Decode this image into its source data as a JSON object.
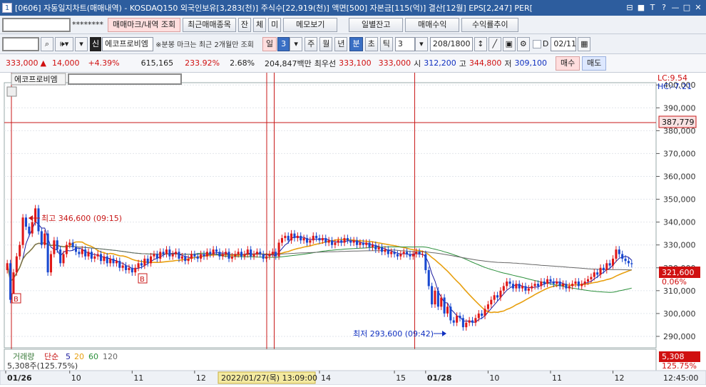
{
  "window": {
    "number": "1",
    "title": "[0606] 자동일지차트(매매내역) - KOSDAQ150 외국인보유[3,283(천)] 주식수[22,919(천)] 액면[500] 자본금[115(억)] 결산[12월] EPS[2,247] PER[",
    "controls": [
      "⊟",
      "■",
      "T",
      "?",
      "—",
      "□",
      "✕"
    ]
  },
  "toolbar1": {
    "account_mask": "********",
    "buttons": [
      "매매마크/내역 조회",
      "최근매매종목",
      "잔",
      "체",
      "미",
      "메모보기",
      "일별잔고",
      "매매수익",
      "수익률추이"
    ]
  },
  "toolbar2": {
    "stock_name": "에코프로비엠",
    "sin_label": "신",
    "note": "※분봉 마크는 최근 2개월만 조회",
    "period_buttons": [
      "일",
      "주",
      "월",
      "년",
      "분",
      "초",
      "틱"
    ],
    "period_value": "3",
    "minute_value": "3",
    "count": "208/1800",
    "date": "02/11",
    "date_check_label": "D"
  },
  "quote": {
    "price": "333,000",
    "change": "14,000",
    "change_pct": "+4.39%",
    "volume": "615,165",
    "vol_ratio": "233.92%",
    "turnover": "2.68%",
    "amount": "204,847백만",
    "best_label": "최우선",
    "ask": "333,100",
    "bid": "333,000",
    "open_label": "시",
    "open": "312,200",
    "high_label": "고",
    "high": "344,800",
    "low_label": "저",
    "low": "309,100",
    "buy": "매수",
    "sell": "매도"
  },
  "chart_panel": {
    "stock_tag": "에코프로비엠",
    "lc": "LC:9.54",
    "hc": "HC:-7.21",
    "crosshair_price": "387,779",
    "current_price": "321,600",
    "current_pct": "0.06%",
    "high_note": "최고 346,600 (09:15)",
    "low_note": "최저 293,600 (09:42)",
    "volume_legend": {
      "label": "거래량",
      "ma_label": "단순",
      "ma": [
        "5",
        "20",
        "60",
        "120"
      ]
    },
    "volume_text": "5,308주(125.75%)",
    "volume_value": "5,308",
    "volume_pct": "125.75%",
    "cursor_time_label": "2022/01/27(목) 13:09:00",
    "clock": "12:45:00",
    "marker_buy": "B"
  },
  "chart_data": {
    "type": "candlestick",
    "interval": "3분",
    "y_ticks": [
      400000,
      390000,
      380000,
      370000,
      360000,
      350000,
      340000,
      330000,
      320000,
      310000,
      300000,
      290000
    ],
    "y_tick_labels": [
      "400,000",
      "390,000",
      "380,000",
      "370,000",
      "360,000",
      "350,000",
      "340,000",
      "330,000",
      "320,000",
      "310,000",
      "300,000",
      "290,000"
    ],
    "ylim": [
      285000,
      401000
    ],
    "x_tick_labels": [
      "01/26",
      "10",
      "11",
      "12",
      "14",
      "15",
      "01/28",
      "10",
      "11",
      "12"
    ],
    "x_tick_times": [
      0,
      20,
      40,
      60,
      100,
      124,
      134,
      154,
      174,
      194
    ],
    "day_dividers": [
      0,
      86,
      131
    ],
    "closes": [
      322000,
      306000,
      318000,
      325000,
      330000,
      342000,
      338000,
      335000,
      340000,
      346000,
      336000,
      330000,
      335000,
      318000,
      326000,
      332000,
      328000,
      322000,
      326000,
      330000,
      331000,
      329000,
      327000,
      326000,
      328000,
      325000,
      327000,
      324000,
      325000,
      326000,
      323000,
      325000,
      322000,
      324000,
      322000,
      323000,
      320000,
      321000,
      319000,
      320000,
      318000,
      320000,
      322000,
      321000,
      324000,
      322000,
      325000,
      326000,
      324000,
      327000,
      326000,
      328000,
      325000,
      326000,
      327000,
      324000,
      325000,
      323000,
      324000,
      326000,
      325000,
      324000,
      326000,
      325000,
      327000,
      326000,
      328000,
      327000,
      325000,
      326000,
      327000,
      324000,
      325000,
      326000,
      327000,
      325000,
      326000,
      328000,
      325000,
      326000,
      327000,
      326000,
      324000,
      325000,
      326000,
      327000,
      325000,
      331000,
      333000,
      334000,
      332000,
      335000,
      333000,
      334000,
      332000,
      333000,
      331000,
      332000,
      334000,
      333000,
      332000,
      333000,
      331000,
      332000,
      330000,
      331000,
      332000,
      331000,
      333000,
      332000,
      331000,
      332000,
      330000,
      331000,
      330000,
      331000,
      329000,
      330000,
      328000,
      329000,
      327000,
      328000,
      326000,
      327000,
      326000,
      325000,
      326000,
      327000,
      326000,
      325000,
      326000,
      327000,
      326000,
      326000,
      319000,
      312000,
      304000,
      310000,
      303000,
      307000,
      300000,
      303000,
      297000,
      296000,
      299000,
      298000,
      294000,
      296000,
      297000,
      296000,
      298000,
      300000,
      299000,
      302000,
      304000,
      306000,
      308000,
      307000,
      310000,
      312000,
      314000,
      313000,
      311000,
      313000,
      311000,
      312000,
      310000,
      311000,
      312000,
      313000,
      312000,
      314000,
      313000,
      315000,
      314000,
      313000,
      314000,
      312000,
      313000,
      311000,
      312000,
      313000,
      314000,
      312000,
      313000,
      314000,
      315000,
      316000,
      318000,
      317000,
      320000,
      319000,
      322000,
      321000,
      324000,
      328000,
      326000,
      324000,
      323000,
      322000,
      321600
    ],
    "series": [
      {
        "name": "5",
        "color": "#1a1a9e"
      },
      {
        "name": "20",
        "color": "#e8a010"
      },
      {
        "name": "60",
        "color": "#2a8f3a"
      },
      {
        "name": "120",
        "color": "#666666"
      }
    ],
    "up_color": "#e01818",
    "down_color": "#1848d0"
  }
}
